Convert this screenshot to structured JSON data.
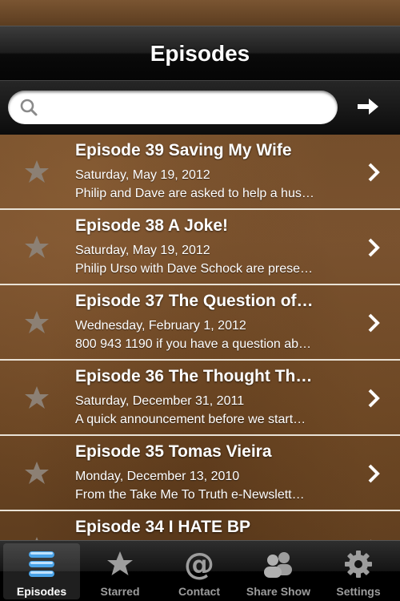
{
  "navbar": {
    "title": "Episodes"
  },
  "search": {
    "value": "",
    "placeholder": ""
  },
  "episodes": [
    {
      "title": "Episode 39 Saving My Wife",
      "date": "Saturday, May 19, 2012",
      "description": "Philip and Dave are asked to help a hus…"
    },
    {
      "title": "Episode 38  A Joke!",
      "date": "Saturday, May 19, 2012",
      "description": "Philip Urso with Dave Schock are prese…"
    },
    {
      "title": "Episode 37  The Question of…",
      "date": "Wednesday, February 1, 2012",
      "description": "800 943 1190 if you have a question ab…"
    },
    {
      "title": "Episode 36  The Thought Th…",
      "date": "Saturday, December 31, 2011",
      "description": "A quick announcement before we start…"
    },
    {
      "title": "Episode 35  Tomas Vieira",
      "date": "Monday, December 13, 2010",
      "description": "From the Take Me To Truth e-Newslett…"
    },
    {
      "title": "Episode 34  I HATE BP",
      "date": "",
      "description": ""
    }
  ],
  "tabs": [
    {
      "label": "Episodes",
      "icon": "episodes-list-icon",
      "active": true
    },
    {
      "label": "Starred",
      "icon": "star-icon",
      "active": false
    },
    {
      "label": "Contact",
      "icon": "at-sign-icon",
      "active": false
    },
    {
      "label": "Share Show",
      "icon": "people-icon",
      "active": false
    },
    {
      "label": "Settings",
      "icon": "gear-icon",
      "active": false
    }
  ],
  "colors": {
    "star": "#8c8074",
    "separator": "#e9e2d6",
    "tab_inactive": "#9d9d9d",
    "tab_active": "#ffffff",
    "episodes_icon": "#4aa3e8"
  }
}
